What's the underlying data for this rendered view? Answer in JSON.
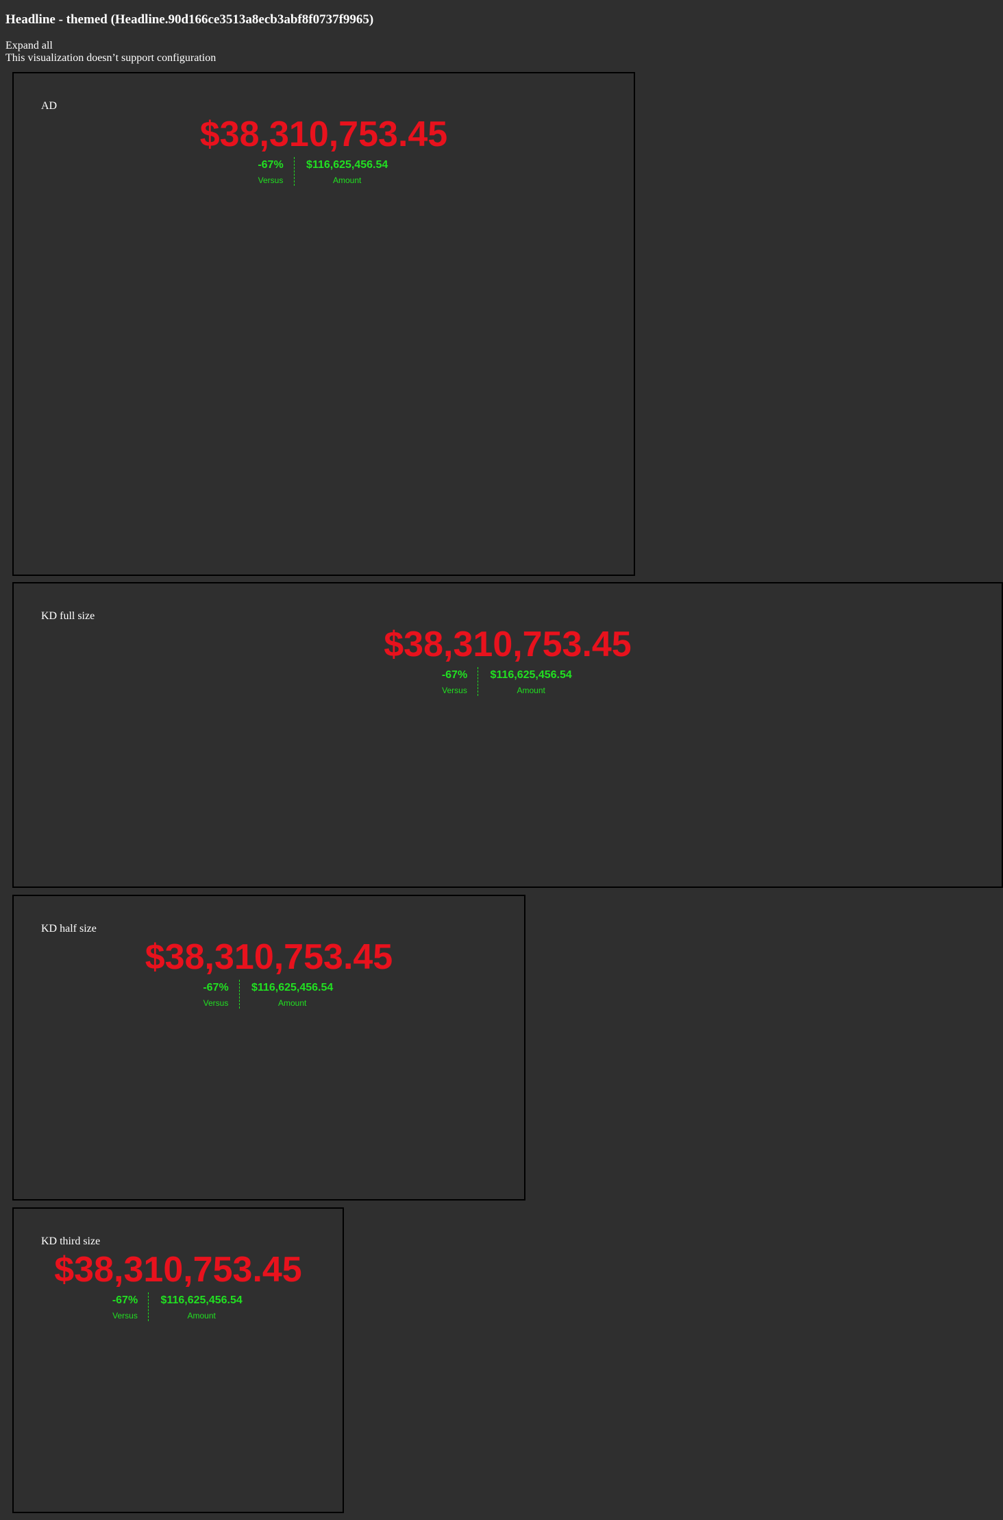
{
  "page": {
    "title": "Headline - themed (Headline.90d166ce3513a8ecb3abf8f0737f9965)",
    "expand_all": "Expand all",
    "no_config": "This visualization doesn’t support configuration"
  },
  "colors": {
    "background": "#2f2f2f",
    "headline_value": "#e8121d",
    "comparison": "#21e021",
    "panel_border": "#000000"
  },
  "panels": [
    {
      "label": "AD",
      "headline": {
        "value": "$38,310,753.45",
        "comparison_value": "-67%",
        "comparison_label": "Versus",
        "secondary_value": "$116,625,456.54",
        "secondary_label": "Amount"
      }
    },
    {
      "label": "KD full size",
      "headline": {
        "value": "$38,310,753.45",
        "comparison_value": "-67%",
        "comparison_label": "Versus",
        "secondary_value": "$116,625,456.54",
        "secondary_label": "Amount"
      }
    },
    {
      "label": "KD half size",
      "headline": {
        "value": "$38,310,753.45",
        "comparison_value": "-67%",
        "comparison_label": "Versus",
        "secondary_value": "$116,625,456.54",
        "secondary_label": "Amount"
      }
    },
    {
      "label": "KD third size",
      "headline": {
        "value": "$38,310,753.45",
        "comparison_value": "-67%",
        "comparison_label": "Versus",
        "secondary_value": "$116,625,456.54",
        "secondary_label": "Amount"
      }
    }
  ]
}
